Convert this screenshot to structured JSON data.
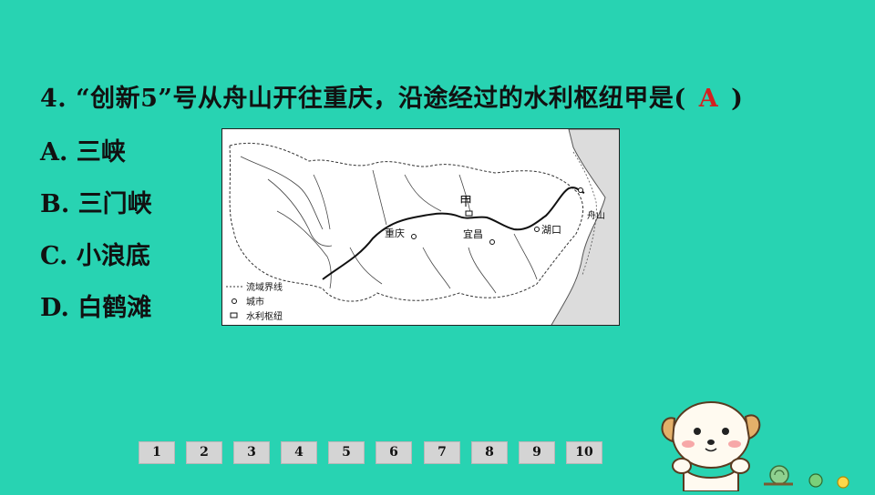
{
  "question": {
    "number_and_text": "4. “创新5”号从舟山开往重庆，沿途经过的水利枢纽甲是(",
    "answer": "A",
    "close_paren": ")"
  },
  "options": [
    {
      "label": "A. 三峡"
    },
    {
      "label": "B. 三门峡"
    },
    {
      "label": "C. 小浪底"
    },
    {
      "label": "D. 白鹤滩"
    }
  ],
  "map": {
    "labels": {
      "jia": "甲",
      "chongqing": "重庆",
      "yichang": "宜昌",
      "hukou": "湖口",
      "zhoushan": "舟山"
    },
    "legend": {
      "boundary": "流域界线",
      "city": "城市",
      "hydro": "水利枢纽"
    }
  },
  "pagination": [
    "1",
    "2",
    "3",
    "4",
    "5",
    "6",
    "7",
    "8",
    "9",
    "10"
  ],
  "colors": {
    "background": "#28d3b2",
    "answer": "#d42020"
  }
}
